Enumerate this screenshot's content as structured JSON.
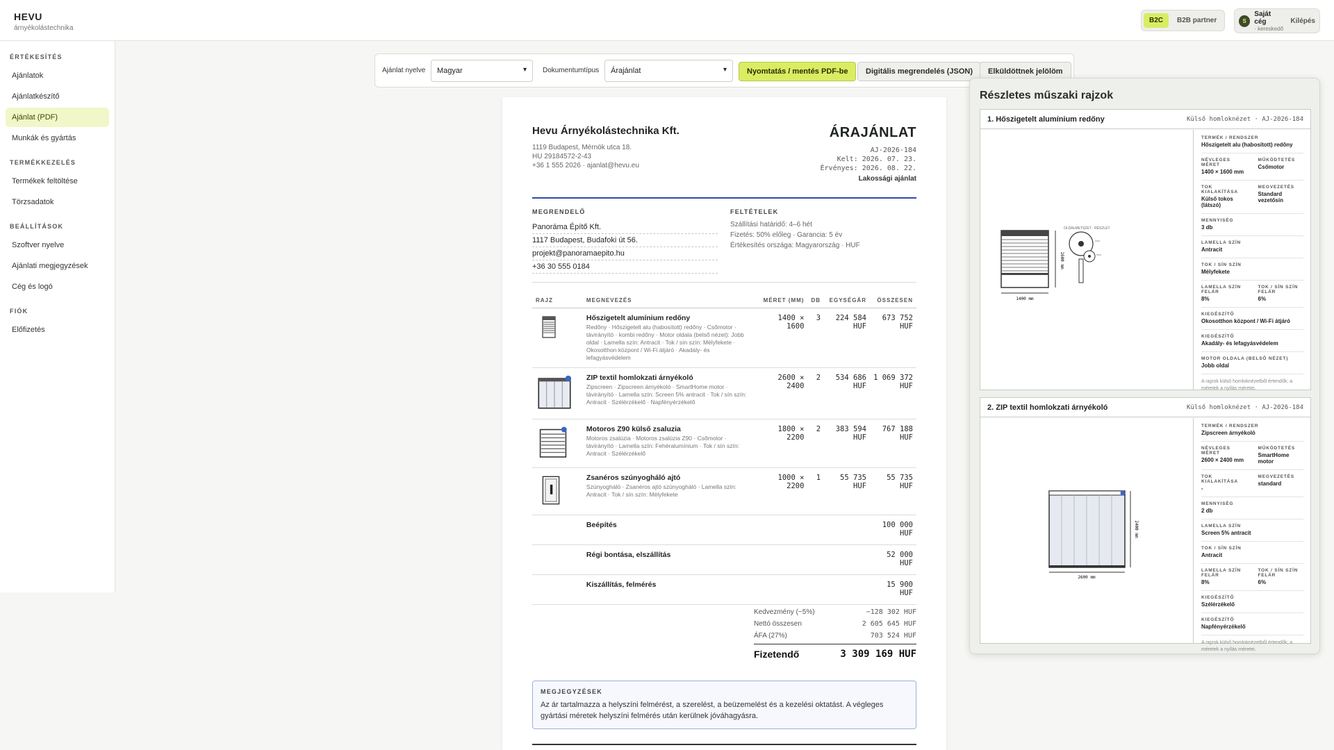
{
  "app": {
    "name": "HEVU",
    "subtitle": "árnyékolástechnika"
  },
  "mode": {
    "b2c": "B2C",
    "b2b": "B2B partner",
    "active": "B2C"
  },
  "user": {
    "initial": "S",
    "company": "Saját cég",
    "role": "· kereskedő",
    "logout": "Kilépés"
  },
  "sidebar": {
    "sections": [
      {
        "title": "ÉRTÉKESÍTÉS",
        "items": [
          "Ajánlatok",
          "Ajánlatkészítő",
          "Ajánlat (PDF)",
          "Munkák és gyártás"
        ]
      },
      {
        "title": "TERMÉKKEZELÉS",
        "items": [
          "Termékek feltöltése",
          "Törzsadatok"
        ]
      },
      {
        "title": "BEÁLLÍTÁSOK",
        "items": [
          "Szoftver nyelve",
          "Ajánlati megjegyzések",
          "Cég és logó"
        ]
      },
      {
        "title": "FIÓK",
        "items": [
          "Előfizetés"
        ]
      }
    ],
    "active": "Ajánlat (PDF)"
  },
  "toolbar": {
    "lang_label": "Ajánlat nyelve",
    "lang_value": "Magyar",
    "doctype_label": "Dokumentumtípus",
    "doctype_value": "Árajánlat",
    "print_btn": "Nyomtatás / mentés PDF-be",
    "json_btn": "Digitális megrendelés (JSON)",
    "sent_btn": "Elküldöttnek jelölöm"
  },
  "doc": {
    "company_name": "Hevu Árnyékolástechnika Kft.",
    "company_address": "1119 Budapest, Mérnök utca 18.",
    "company_tax": "HU 29184572-2-43",
    "company_contact": "+36 1 555 2026 · ajanlat@hevu.eu",
    "title": "ÁRAJÁNLAT",
    "number": "AJ-2026-184",
    "date": "Kelt: 2026. 07. 23.",
    "valid": "Érvényes: 2026. 08. 22.",
    "type": "Lakossági ajánlat",
    "customer_heading": "MEGRENDELŐ",
    "customer": [
      "Panoráma Építő Kft.",
      "1117 Budapest, Budafoki út 56.",
      "projekt@panoramaepito.hu",
      "+36 30 555 0184"
    ],
    "terms_heading": "FELTÉTELEK",
    "terms": [
      "Szállítási határidő: 4–6 hét",
      "Fizetés: 50% előleg · Garancia: 5 év",
      "Értékesítés országa: Magyarország · HUF"
    ],
    "table_headers": {
      "drawing": "RAJZ",
      "name": "MEGNEVEZÉS",
      "size": "MÉRET (MM)",
      "qty": "DB",
      "unit": "EGYSÉGÁR",
      "total": "ÖSSZESEN"
    },
    "items": [
      {
        "name": "Hőszigetelt alumínium redőny",
        "desc": "Redőny · Hőszigetelt alu (habosított) redőny · Csőmotor · távirányító · kombi redőny · Motor oldala (belső nézet): Jobb oldal · Lamella szín: Antracit · Tok / sín szín: Mélyfekete · Okosotthon központ / Wi-Fi átjáró · Akadály- és lefagyásvédelem",
        "size": "1400 × 1600",
        "qty": "3",
        "unit": "224 584 HUF",
        "total": "673 752 HUF",
        "icon": "roller-shutter-thumb-icon"
      },
      {
        "name": "ZIP textil homlokzati árnyékoló",
        "desc": "Zipscreen · Zipscreen árnyékoló · SmartHome motor · távirányító · Lamella szín: Screen 5% antracit · Tok / sín szín: Antracit · Szélérzékelő · Napfényérzékelő",
        "size": "2600 × 2400",
        "qty": "2",
        "unit": "534 686 HUF",
        "total": "1 069 372 HUF",
        "icon": "zip-screen-thumb-icon"
      },
      {
        "name": "Motoros Z90 külső zsaluzia",
        "desc": "Motoros zsalúzia · Motoros zsalúzia Z90 · Csőmotor · távirányító · Lamella szín: Fehéralumínium · Tok / sín szín: Antracit · Szélérzékelő",
        "size": "1800 × 2200",
        "qty": "2",
        "unit": "383 594 HUF",
        "total": "767 188 HUF",
        "icon": "venetian-blind-thumb-icon"
      },
      {
        "name": "Zsanéros szúnyogháló ajtó",
        "desc": "Szúnyogháló · Zsanéros ajtó szúnyogháló · Lamella szín: Antracit · Tok / sín szín: Mélyfekete",
        "size": "1000 × 2200",
        "qty": "1",
        "unit": "55 735 HUF",
        "total": "55 735 HUF",
        "icon": "insect-screen-door-thumb-icon"
      }
    ],
    "extras": [
      {
        "name": "Beépítés",
        "total": "100 000 HUF"
      },
      {
        "name": "Régi bontása, elszállítás",
        "total": "52 000 HUF"
      },
      {
        "name": "Kiszállítás, felmérés",
        "total": "15 900 HUF"
      }
    ],
    "totals": [
      {
        "label": "Kedvezmény (−5%)",
        "value": "−128 302 HUF"
      },
      {
        "label": "Nettó összesen",
        "value": "2 605 645 HUF"
      },
      {
        "label": "ÁFA (27%)",
        "value": "703 524 HUF"
      }
    ],
    "grand_label": "Fizetendő",
    "grand_value": "3 309 169 HUF",
    "notes_heading": "MEGJEGYZÉSEK",
    "notes_text": "Az ár tartalmazza a helyszíni felmérést, a szerelést, a beüzemelést és a kezelési oktatást. A végleges gyártási méretek helyszíni felmérés után kerülnek jóváhagyásra."
  },
  "drawings": {
    "title": "Részletes műszaki rajzok",
    "cards": [
      {
        "title": "1. Hőszigetelt alumínium redőny",
        "ref": "Külső homloknézet · AJ-2026-184",
        "width_label": "1400 mm",
        "height_label": "1600 mm",
        "section_label": "OLDALMETSZET · RÉSZLET",
        "specs": [
          [
            {
              "k": "TERMÉK / RENDSZER",
              "v": "Hőszigetelt alu (habosított) redőny"
            }
          ],
          [
            {
              "k": "NÉVLEGES MÉRET",
              "v": "1400 × 1600 mm"
            },
            {
              "k": "MŰKÖDTETÉS",
              "v": "Csőmotor"
            }
          ],
          [
            {
              "k": "TOK KIALAKÍTÁSA",
              "v": "Külső tokos (látszó)"
            },
            {
              "k": "MEGVEZETÉS",
              "v": "Standard vezetősín"
            }
          ],
          [
            {
              "k": "MENNYISÉG",
              "v": "3 db"
            }
          ],
          [
            {
              "k": "LAMELLA SZÍN",
              "v": "Antracit"
            }
          ],
          [
            {
              "k": "TOK / SÍN SZÍN",
              "v": "Mélyfekete"
            }
          ],
          [
            {
              "k": "LAMELLA SZÍN FELÁR",
              "v": "8%"
            },
            {
              "k": "TOK / SÍN SZÍN FELÁR",
              "v": "6%"
            }
          ],
          [
            {
              "k": "KIEGÉSZÍTŐ",
              "v": "Okosotthon központ / Wi-Fi átjáró"
            }
          ],
          [
            {
              "k": "KIEGÉSZÍTŐ",
              "v": "Akadály- és lefagyásvédelem"
            }
          ],
          [
            {
              "k": "MOTOR OLDALA (BELSŐ NÉZET)",
              "v": "Jobb oldal"
            }
          ]
        ],
        "note": "A rajzok külső homloknézetből értendők; a méretek a nyílás méretei."
      },
      {
        "title": "2. ZIP textil homlokzati árnyékoló",
        "ref": "Külső homloknézet · AJ-2026-184",
        "width_label": "2600 mm",
        "height_label": "2400 mm",
        "specs": [
          [
            {
              "k": "TERMÉK / RENDSZER",
              "v": "Zipscreen árnyékoló"
            }
          ],
          [
            {
              "k": "NÉVLEGES MÉRET",
              "v": "2600 × 2400 mm"
            },
            {
              "k": "MŰKÖDTETÉS",
              "v": "SmartHome motor"
            }
          ],
          [
            {
              "k": "TOK KIALAKÍTÁSA",
              "v": "-"
            },
            {
              "k": "MEGVEZETÉS",
              "v": "standard"
            }
          ],
          [
            {
              "k": "MENNYISÉG",
              "v": "2 db"
            }
          ],
          [
            {
              "k": "LAMELLA SZÍN",
              "v": "Screen 5% antracit"
            }
          ],
          [
            {
              "k": "TOK / SÍN SZÍN",
              "v": "Antracit"
            }
          ],
          [
            {
              "k": "LAMELLA SZÍN FELÁR",
              "v": "8%"
            },
            {
              "k": "TOK / SÍN SZÍN FELÁR",
              "v": "6%"
            }
          ],
          [
            {
              "k": "KIEGÉSZÍTŐ",
              "v": "Szélérzékelő"
            }
          ],
          [
            {
              "k": "KIEGÉSZÍTŐ",
              "v": "Napfényérzékelő"
            }
          ]
        ],
        "note": "A rajzok külső homloknézetből értendők; a méretek a nyílás méretei."
      }
    ]
  },
  "colors": {
    "accent": "#d9ec63",
    "doc_rule": "#2d4aa6",
    "notes_border": "#9db0dc"
  }
}
